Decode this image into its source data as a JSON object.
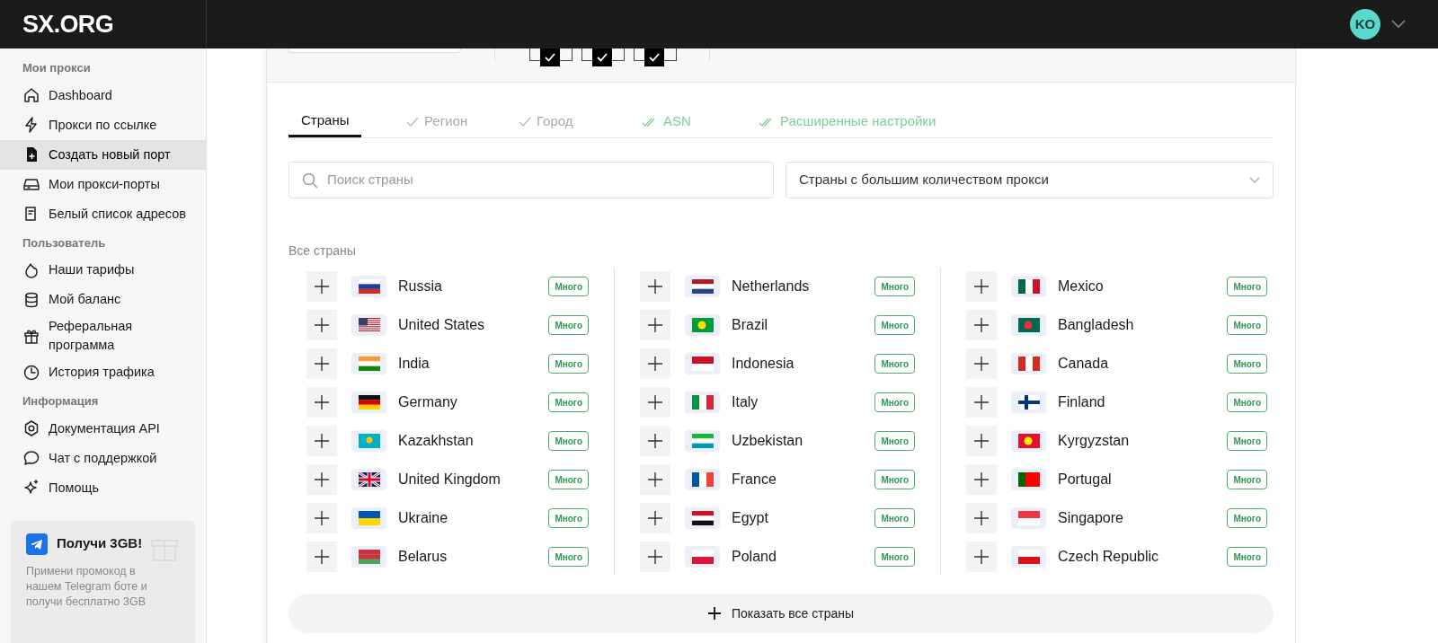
{
  "header": {
    "logo": "SX.ORG",
    "avatar": "KO"
  },
  "sidebar": {
    "sections": [
      {
        "title": "Мои прокси",
        "items": [
          {
            "label": "Dashboard",
            "selected": false
          },
          {
            "label": "Прокси по ссылке",
            "selected": false
          },
          {
            "label": "Создать новый порт",
            "selected": true
          },
          {
            "label": "Мои прокси-порты",
            "selected": false
          },
          {
            "label": "Белый список адресов",
            "selected": false
          }
        ]
      },
      {
        "title": "Пользователь",
        "items": [
          {
            "label": "Наши тарифы",
            "selected": false
          },
          {
            "label": "Мой баланс",
            "selected": false
          },
          {
            "label": "Реферальная программа",
            "selected": false
          },
          {
            "label": "История трафика",
            "selected": false
          }
        ]
      },
      {
        "title": "Информация",
        "items": [
          {
            "label": "Документация API",
            "selected": false
          },
          {
            "label": "Чат с поддержкой",
            "selected": false
          },
          {
            "label": "Помощь",
            "selected": false
          }
        ]
      }
    ],
    "promo": {
      "title": "Получи 3GB!",
      "text": "Примени промокод в нашем Telegram боте и получи бесплатно 3GB"
    }
  },
  "top_strip": {
    "checkboxes": [
      {
        "checked": true
      },
      {
        "checked": true
      },
      {
        "checked": true
      }
    ]
  },
  "tabs": [
    {
      "label": "Страны",
      "selected": true,
      "kind": "plain"
    },
    {
      "label": "Регион",
      "selected": false,
      "kind": "check"
    },
    {
      "label": "Город",
      "selected": false,
      "kind": "check"
    },
    {
      "label": "ASN",
      "selected": false,
      "kind": "double-check"
    },
    {
      "label": "Расширенные настройки",
      "selected": false,
      "kind": "double-check"
    }
  ],
  "search": {
    "placeholder": "Поиск страны"
  },
  "sort_dropdown": {
    "value": "Страны с большим количеством прокси"
  },
  "countries_title": "Все страны",
  "columns": [
    [
      {
        "name": "Russia",
        "badge": "Много"
      },
      {
        "name": "United States",
        "badge": "Много"
      },
      {
        "name": "India",
        "badge": "Много"
      },
      {
        "name": "Germany",
        "badge": "Много"
      },
      {
        "name": "Kazakhstan",
        "badge": "Много"
      },
      {
        "name": "United Kingdom",
        "badge": "Много"
      },
      {
        "name": "Ukraine",
        "badge": "Много"
      },
      {
        "name": "Belarus",
        "badge": "Много"
      }
    ],
    [
      {
        "name": "Netherlands",
        "badge": "Много"
      },
      {
        "name": "Brazil",
        "badge": "Много"
      },
      {
        "name": "Indonesia",
        "badge": "Много"
      },
      {
        "name": "Italy",
        "badge": "Много"
      },
      {
        "name": "Uzbekistan",
        "badge": "Много"
      },
      {
        "name": "France",
        "badge": "Много"
      },
      {
        "name": "Egypt",
        "badge": "Много"
      },
      {
        "name": "Poland",
        "badge": "Много"
      }
    ],
    [
      {
        "name": "Mexico",
        "badge": "Много"
      },
      {
        "name": "Bangladesh",
        "badge": "Много"
      },
      {
        "name": "Canada",
        "badge": "Много"
      },
      {
        "name": "Finland",
        "badge": "Много"
      },
      {
        "name": "Kyrgyzstan",
        "badge": "Много"
      },
      {
        "name": "Portugal",
        "badge": "Много"
      },
      {
        "name": "Singapore",
        "badge": "Много"
      },
      {
        "name": "Czech Republic",
        "badge": "Много"
      }
    ]
  ],
  "show_all_button": "Показать все страны"
}
